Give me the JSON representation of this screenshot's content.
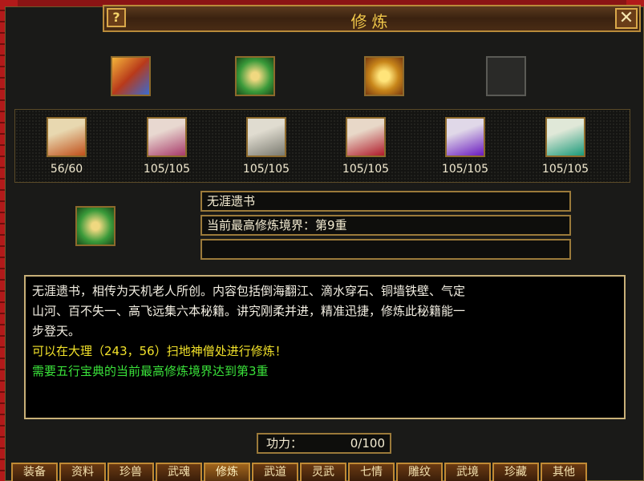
{
  "window": {
    "title": "修炼",
    "help_label": "?",
    "close_label": "✕"
  },
  "top_icons": [
    {
      "name": "book-icon"
    },
    {
      "name": "green-scroll-bundle-icon"
    },
    {
      "name": "gold-scroll-bundle-icon"
    },
    {
      "name": "empty-slot-icon"
    }
  ],
  "scrolls": [
    {
      "count": "56/60"
    },
    {
      "count": "105/105"
    },
    {
      "count": "105/105"
    },
    {
      "count": "105/105"
    },
    {
      "count": "105/105"
    },
    {
      "count": "105/105"
    }
  ],
  "selected": {
    "name": "无涯遗书",
    "realm": "当前最高修炼境界：第9重",
    "extra": ""
  },
  "description": {
    "line1": "无涯遗书，相传为天机老人所创。内容包括倒海翻江、滴水穿石、铜墙铁壁、气定",
    "line2": "山河、百不失一、高飞远集六本秘籍。讲究刚柔并进，精准迅捷，修炼此秘籍能一",
    "line3": "步登天。",
    "location": "可以在大理（243，56）扫地神僧处进行修炼！",
    "requirement": "需要五行宝典的当前最高修炼境界达到第3重"
  },
  "power": {
    "label": "功力：",
    "value": "0/100"
  },
  "tabs": [
    "装备",
    "资料",
    "珍兽",
    "武魂",
    "修炼",
    "武道",
    "灵武",
    "七情",
    "雕纹",
    "武境",
    "珍藏",
    "其他"
  ],
  "active_tab": "修炼",
  "colors": {
    "accent": "#f1c84a",
    "location_text": "#f2e22a",
    "requirement_text": "#3ae23a"
  }
}
